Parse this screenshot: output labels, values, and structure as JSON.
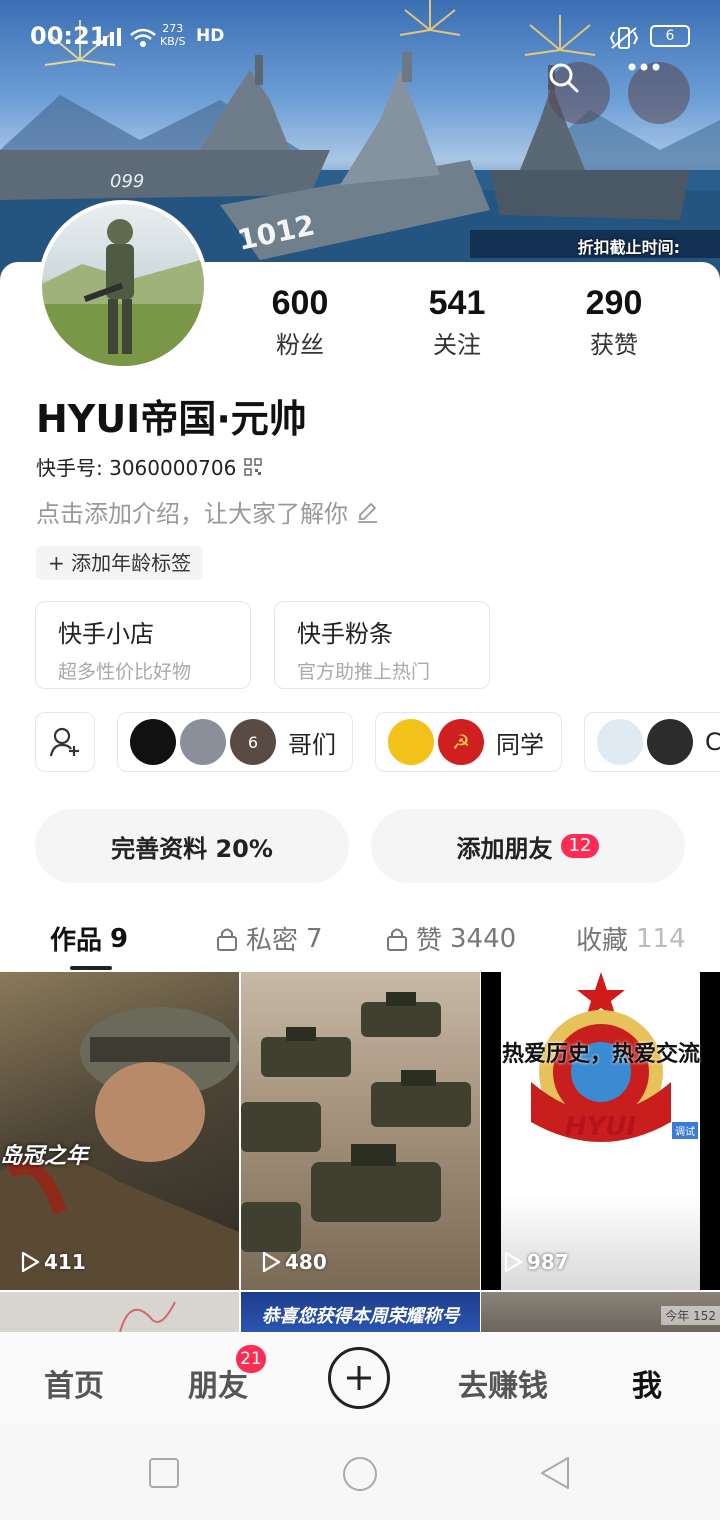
{
  "status_bar": {
    "time": "00:21",
    "speed_value": "273",
    "speed_unit": "KB/S",
    "hd": "HD",
    "battery": "6"
  },
  "banner": {
    "deadline_text": "折扣截止时间:"
  },
  "profile": {
    "username": "HYUI帝国·元帅",
    "kuaishou_id": "快手号: 3060000706",
    "intro_placeholder": "点击添加介绍，让大家了解你",
    "age_tag": "+ 添加年龄标签",
    "stats": [
      {
        "value": "600",
        "label": "粉丝"
      },
      {
        "value": "541",
        "label": "关注"
      },
      {
        "value": "290",
        "label": "获赞"
      }
    ]
  },
  "services": [
    {
      "title": "快手小店",
      "subtitle": "超多性价比好物"
    },
    {
      "title": "快手粉条",
      "subtitle": "官方助推上热门"
    }
  ],
  "groups": [
    {
      "label": "哥们",
      "count_badge": "6"
    },
    {
      "label": "同学"
    },
    {
      "label": "C"
    }
  ],
  "actions": {
    "complete_profile": "完善资料 20%",
    "add_friends": "添加朋友",
    "add_friends_badge": "12"
  },
  "tabs": [
    {
      "label": "作品",
      "count": "9",
      "locked": false,
      "active": true
    },
    {
      "label": "私密",
      "count": "7",
      "locked": true,
      "active": false
    },
    {
      "label": "赞",
      "count": "3440",
      "locked": true,
      "active": false
    },
    {
      "label": "收藏",
      "count": "114",
      "locked": false,
      "active": false
    }
  ],
  "videos": [
    {
      "views": "411",
      "overlay_text": "岛冠之年"
    },
    {
      "views": "480"
    },
    {
      "views": "987",
      "overlay_text": "热爱历史，热爱交流",
      "logo_text": "HYUI",
      "corner_tag": "调试"
    },
    {
      "views": ""
    },
    {
      "views": "",
      "overlay_text": "恭喜您获得本周荣耀称号"
    },
    {
      "views": "",
      "corner_tag": "今年 152"
    }
  ],
  "bottom_nav": {
    "items": [
      "首页",
      "朋友",
      "去赚钱",
      "我"
    ],
    "friends_badge": "21"
  },
  "colors": {
    "accent_red": "#fe2c55",
    "pill_bg": "#f5f5f5"
  }
}
